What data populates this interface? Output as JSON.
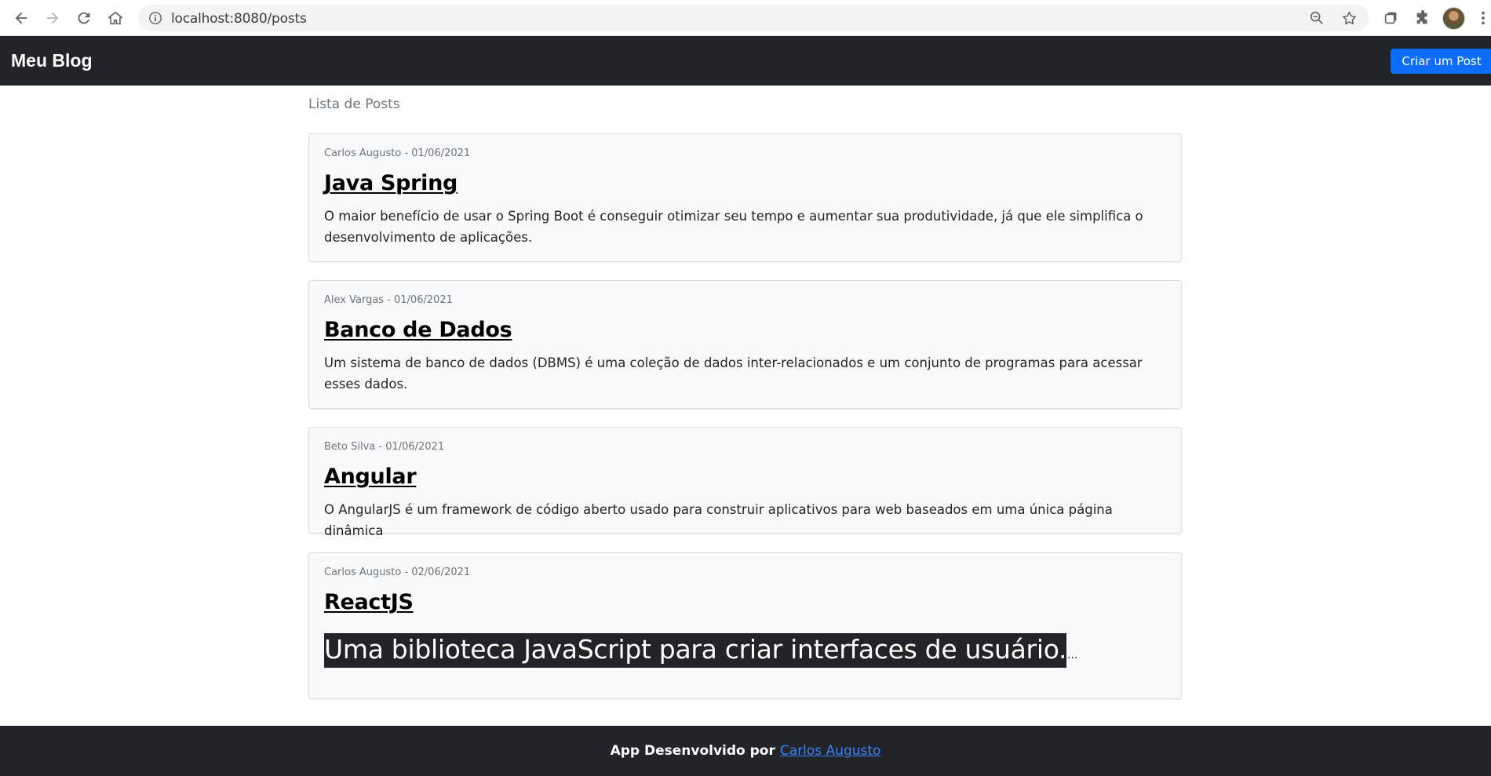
{
  "browser": {
    "url": "localhost:8080/posts",
    "icons": {
      "back": "arrow-left-icon",
      "forward": "arrow-right-icon",
      "reload": "reload-icon",
      "home": "home-icon",
      "info": "info-icon",
      "zoom": "zoom-icon",
      "bookmark": "star-icon",
      "tabs": "tab-search-icon",
      "extensions": "puzzle-icon",
      "menu": "kebab-menu-icon"
    }
  },
  "navbar": {
    "brand": "Meu Blog",
    "create_button": "Criar um Post"
  },
  "main": {
    "section_title": "Lista de Posts",
    "posts": [
      {
        "meta": "Carlos Augusto - 01/06/2021",
        "title": "Java Spring",
        "text": "O maior benefício de usar o Spring Boot é conseguir otimizar seu tempo e aumentar sua produtividade, já que ele simplifica o desenvolvimento de aplicações."
      },
      {
        "meta": "Alex Vargas - 01/06/2021",
        "title": "Banco de Dados",
        "text": "Um sistema de banco de dados (DBMS) é uma coleção de dados inter-relacionados e um conjunto de programas para acessar esses dados."
      },
      {
        "meta": "Beto Silva - 01/06/2021",
        "title": "Angular",
        "text": "O AngularJS é um framework de código aberto usado para construir aplicativos para web baseados em uma única página dinâmica"
      },
      {
        "meta": "Carlos Augusto - 02/06/2021",
        "title": "ReactJS",
        "text": "Uma biblioteca JavaScript para criar interfaces de usuário.",
        "ellipsis": "..."
      }
    ]
  },
  "footer": {
    "text": "App Desenvolvido por",
    "link": "Carlos Augusto"
  },
  "colors": {
    "navbar_bg": "#212529",
    "primary_button": "#0d6efd",
    "card_bg": "#f8f9fa",
    "footer_link": "#3b82f6"
  }
}
